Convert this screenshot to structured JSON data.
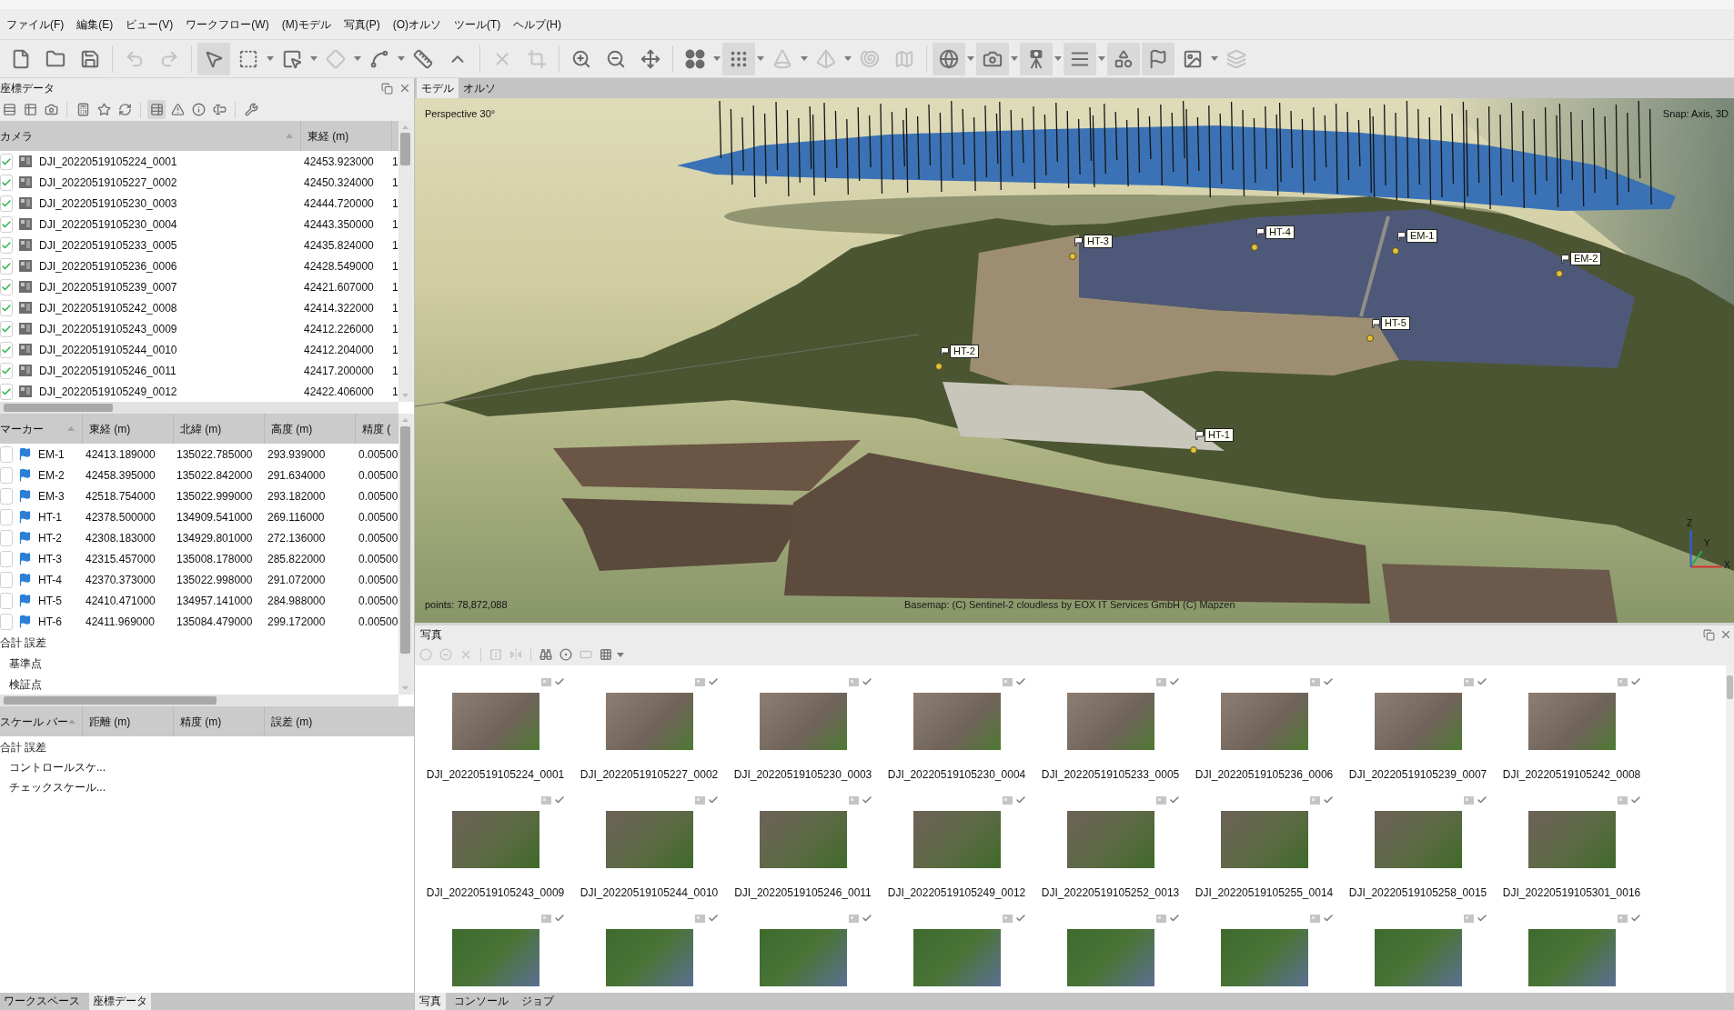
{
  "menu": [
    "ファイル(F)",
    "編集(E)",
    "ビュー(V)",
    "ワークフロー(W)",
    "(M)モデル",
    "写真(P)",
    "(O)オルソ",
    "ツール(T)",
    "ヘルプ(H)"
  ],
  "toolbar": [
    {
      "disabled": false,
      "pressed": false,
      "dropdown": false
    },
    {
      "disabled": false,
      "pressed": false,
      "dropdown": false
    },
    {
      "disabled": false,
      "pressed": false,
      "dropdown": false
    },
    {
      "disabled": true,
      "pressed": false,
      "dropdown": false
    },
    {
      "disabled": true,
      "pressed": false,
      "dropdown": false
    },
    {
      "disabled": false,
      "pressed": true,
      "dropdown": false
    },
    {
      "disabled": false,
      "pressed": false,
      "dropdown": true
    },
    {
      "disabled": false,
      "pressed": false,
      "dropdown": true
    },
    {
      "disabled": true,
      "pressed": false,
      "dropdown": true
    },
    {
      "disabled": false,
      "pressed": false,
      "dropdown": true
    },
    {
      "disabled": false,
      "pressed": false,
      "dropdown": false
    },
    {
      "disabled": false,
      "pressed": false,
      "dropdown": false
    },
    {
      "disabled": true,
      "pressed": false,
      "dropdown": false
    },
    {
      "disabled": true,
      "pressed": false,
      "dropdown": false
    },
    {
      "disabled": false,
      "pressed": false,
      "dropdown": false
    },
    {
      "disabled": false,
      "pressed": false,
      "dropdown": false
    },
    {
      "disabled": false,
      "pressed": false,
      "dropdown": false
    },
    {
      "disabled": false,
      "pressed": false,
      "dropdown": true
    },
    {
      "disabled": false,
      "pressed": true,
      "dropdown": true
    },
    {
      "disabled": true,
      "pressed": false,
      "dropdown": true
    },
    {
      "disabled": true,
      "pressed": false,
      "dropdown": true
    },
    {
      "disabled": true,
      "pressed": false,
      "dropdown": false
    },
    {
      "disabled": true,
      "pressed": false,
      "dropdown": false
    },
    {
      "disabled": false,
      "pressed": true,
      "dropdown": true
    },
    {
      "disabled": false,
      "pressed": true,
      "dropdown": true
    },
    {
      "disabled": false,
      "pressed": true,
      "dropdown": true
    },
    {
      "disabled": false,
      "pressed": true,
      "dropdown": true
    },
    {
      "disabled": false,
      "pressed": true,
      "dropdown": false
    },
    {
      "disabled": false,
      "pressed": true,
      "dropdown": false
    },
    {
      "disabled": false,
      "pressed": false,
      "dropdown": true
    },
    {
      "disabled": true,
      "pressed": false,
      "dropdown": false
    }
  ],
  "reference_panel": {
    "title": "座標データ",
    "toolbar": [
      {
        "pressed": false
      },
      {
        "pressed": false
      },
      {
        "pressed": false
      },
      {
        "pressed": false
      },
      {
        "pressed": false
      },
      {
        "pressed": false
      },
      {
        "pressed": true
      },
      {
        "pressed": false
      },
      {
        "pressed": false
      },
      {
        "pressed": false
      },
      {
        "pressed": false
      }
    ],
    "cameras": {
      "columns": [
        "カメラ",
        "東経 (m)"
      ],
      "rows": [
        {
          "checked": true,
          "label": "DJI_20220519105224_0001",
          "east": "42453.923000",
          "column_3": "1"
        },
        {
          "checked": true,
          "label": "DJI_20220519105227_0002",
          "east": "42450.324000",
          "column_3": "1"
        },
        {
          "checked": true,
          "label": "DJI_20220519105230_0003",
          "east": "42444.720000",
          "column_3": "1"
        },
        {
          "checked": true,
          "label": "DJI_20220519105230_0004",
          "east": "42443.350000",
          "column_3": "1"
        },
        {
          "checked": true,
          "label": "DJI_20220519105233_0005",
          "east": "42435.824000",
          "column_3": "1"
        },
        {
          "checked": true,
          "label": "DJI_20220519105236_0006",
          "east": "42428.549000",
          "column_3": "1"
        },
        {
          "checked": true,
          "label": "DJI_20220519105239_0007",
          "east": "42421.607000",
          "column_3": "1"
        },
        {
          "checked": true,
          "label": "DJI_20220519105242_0008",
          "east": "42414.322000",
          "column_3": "1"
        },
        {
          "checked": true,
          "label": "DJI_20220519105243_0009",
          "east": "42412.226000",
          "column_3": "1"
        },
        {
          "checked": true,
          "label": "DJI_20220519105244_0010",
          "east": "42412.204000",
          "column_3": "1"
        },
        {
          "checked": true,
          "label": "DJI_20220519105246_0011",
          "east": "42417.200000",
          "column_3": "1"
        },
        {
          "checked": true,
          "label": "DJI_20220519105249_0012",
          "east": "42422.406000",
          "column_3": "1"
        }
      ]
    },
    "markers": {
      "columns": [
        "マーカー",
        "東経 (m)",
        "北緯 (m)",
        "高度 (m)",
        "精度 ("
      ],
      "rows": [
        {
          "checked": false,
          "label": "EM-1",
          "east": "42413.189000",
          "north": "135022.785000",
          "altitude": "293.939000",
          "accuracy": "0.00500"
        },
        {
          "checked": false,
          "label": "EM-2",
          "east": "42458.395000",
          "north": "135022.842000",
          "altitude": "291.634000",
          "accuracy": "0.00500"
        },
        {
          "checked": false,
          "label": "EM-3",
          "east": "42518.754000",
          "north": "135022.999000",
          "altitude": "293.182000",
          "accuracy": "0.00500"
        },
        {
          "checked": false,
          "label": "HT-1",
          "east": "42378.500000",
          "north": "134909.541000",
          "altitude": "269.116000",
          "accuracy": "0.00500"
        },
        {
          "checked": false,
          "label": "HT-2",
          "east": "42308.183000",
          "north": "134929.801000",
          "altitude": "272.136000",
          "accuracy": "0.00500"
        },
        {
          "checked": false,
          "label": "HT-3",
          "east": "42315.457000",
          "north": "135008.178000",
          "altitude": "285.822000",
          "accuracy": "0.00500"
        },
        {
          "checked": false,
          "label": "HT-4",
          "east": "42370.373000",
          "north": "135022.998000",
          "altitude": "291.072000",
          "accuracy": "0.00500"
        },
        {
          "checked": false,
          "label": "HT-5",
          "east": "42410.471000",
          "north": "134957.141000",
          "altitude": "284.988000",
          "accuracy": "0.00500"
        },
        {
          "checked": false,
          "label": "HT-6",
          "east": "42411.969000",
          "north": "135084.479000",
          "altitude": "299.172000",
          "accuracy": "0.00500"
        }
      ],
      "summary": {
        "title": "合計 誤差",
        "items": [
          "基準点",
          "検証点"
        ]
      }
    },
    "scalebars": {
      "columns": [
        "スケール バー",
        "距離 (m)",
        "精度 (m)",
        "誤差 (m)"
      ],
      "summary": {
        "title": "合計 誤差",
        "items": [
          "コントロールスケ...",
          "チェックスケール..."
        ]
      }
    }
  },
  "left_dock_tabs": [
    {
      "label": "ワークスペース",
      "selected": false
    },
    {
      "label": "座標データ",
      "selected": true
    }
  ],
  "view_tabs": [
    {
      "label": "モデル",
      "selected": true
    },
    {
      "label": "オルソ",
      "selected": false
    }
  ],
  "viewport": {
    "projection": "Perspective 30°",
    "snap": "Snap: Axis, 3D",
    "points": "points: 78,872,088",
    "attribution": "Basemap: (C) Sentinel-2 cloudless by EOX IT Services GmbH (C) Mapzen",
    "markers": [
      {
        "label": "HT-3"
      },
      {
        "label": "HT-4"
      },
      {
        "label": "EM-1"
      },
      {
        "label": "EM-2"
      },
      {
        "label": "HT-5"
      },
      {
        "label": "HT-2"
      },
      {
        "label": "HT-1"
      }
    ],
    "axes": [
      {
        "label": "Z"
      },
      {
        "label": "Y"
      },
      {
        "label": "X"
      }
    ]
  },
  "photos_panel": {
    "title": "写真",
    "toolbar": [
      {
        "disabled": true,
        "dropdown": false
      },
      {
        "disabled": true,
        "dropdown": false
      },
      {
        "disabled": true,
        "dropdown": false
      },
      {
        "disabled": true,
        "dropdown": false
      },
      {
        "disabled": true,
        "dropdown": false
      },
      {
        "disabled": false,
        "dropdown": false
      },
      {
        "disabled": false,
        "dropdown": false
      },
      {
        "disabled": true,
        "dropdown": false
      },
      {
        "disabled": false,
        "dropdown": true
      }
    ],
    "photos": [
      {
        "label": "DJI_20220519105224_0001",
        "aligned": true
      },
      {
        "label": "DJI_20220519105227_0002",
        "aligned": true
      },
      {
        "label": "DJI_20220519105230_0003",
        "aligned": true
      },
      {
        "label": "DJI_20220519105230_0004",
        "aligned": true
      },
      {
        "label": "DJI_20220519105233_0005",
        "aligned": true
      },
      {
        "label": "DJI_20220519105236_0006",
        "aligned": true
      },
      {
        "label": "DJI_20220519105239_0007",
        "aligned": true
      },
      {
        "label": "DJI_20220519105242_0008",
        "aligned": true
      },
      {
        "label": "DJI_20220519105243_0009",
        "aligned": true
      },
      {
        "label": "DJI_20220519105244_0010",
        "aligned": true
      },
      {
        "label": "DJI_20220519105246_0011",
        "aligned": true
      },
      {
        "label": "DJI_20220519105249_0012",
        "aligned": true
      },
      {
        "label": "DJI_20220519105252_0013",
        "aligned": true
      },
      {
        "label": "DJI_20220519105255_0014",
        "aligned": true
      },
      {
        "label": "DJI_20220519105258_0015",
        "aligned": true
      },
      {
        "label": "DJI_20220519105301_0016",
        "aligned": true
      },
      {
        "aligned": true
      },
      {
        "aligned": true
      },
      {
        "aligned": true
      },
      {
        "aligned": true
      },
      {
        "aligned": true
      },
      {
        "aligned": true
      },
      {
        "aligned": true
      },
      {
        "aligned": true
      }
    ]
  },
  "bottom_tabs": [
    {
      "label": "写真",
      "selected": true
    },
    {
      "label": "コンソール",
      "selected": false
    },
    {
      "label": "ジョブ",
      "selected": false
    }
  ]
}
